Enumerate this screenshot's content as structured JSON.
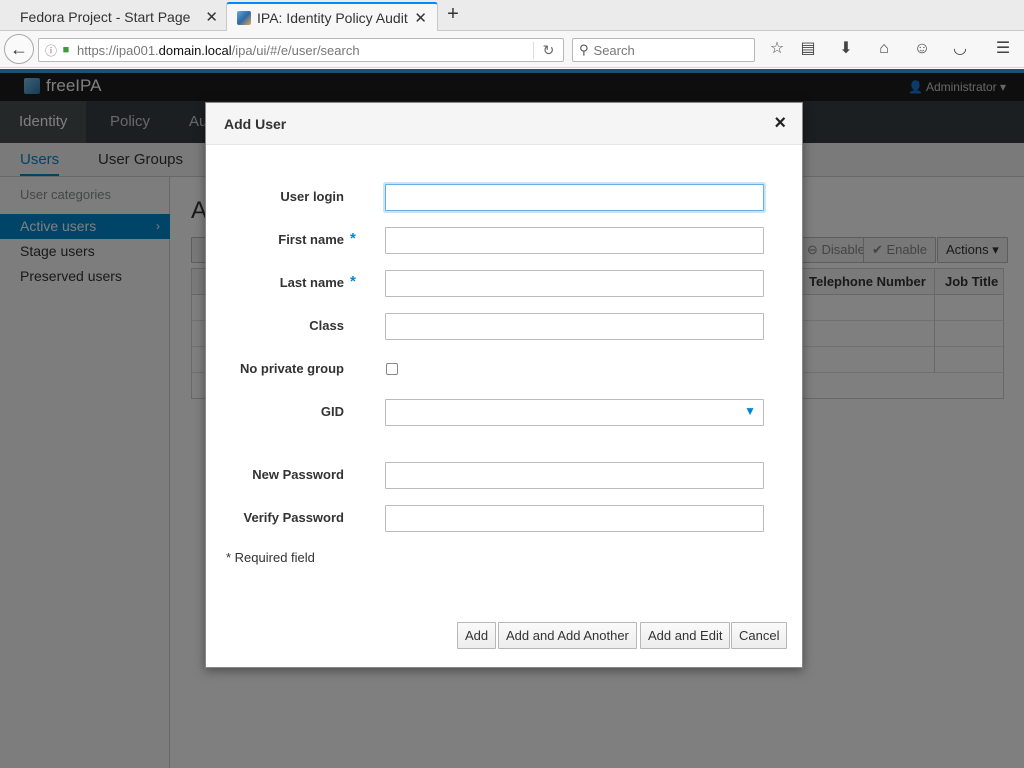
{
  "browser": {
    "tabs": [
      {
        "title": "Fedora Project - Start Page",
        "active": false
      },
      {
        "title": "IPA: Identity Policy Audit",
        "active": true
      }
    ],
    "url_prefix": "https://ipa001.",
    "url_host": "domain.local",
    "url_path": "/ipa/ui/#/e/user/search",
    "search_placeholder": "Search"
  },
  "app": {
    "brand": "freeIPA",
    "user_menu": "Administrator",
    "menu": [
      "Identity",
      "Policy",
      "Au"
    ],
    "subnav": [
      "Users",
      "User Groups"
    ],
    "sidebar": {
      "heading": "User categories",
      "items": [
        "Active users",
        "Stage users",
        "Preserved users"
      ]
    },
    "page_heading": "A",
    "toolbar": {
      "disable": "Disable",
      "enable": "Enable",
      "actions": "Actions"
    },
    "table": {
      "columns": [
        "Telephone Number",
        "Job Title"
      ]
    }
  },
  "dialog": {
    "title": "Add User",
    "fields": {
      "user_login": "User login",
      "first_name": "First name",
      "last_name": "Last name",
      "class": "Class",
      "no_private_group": "No private group",
      "gid": "GID",
      "new_password": "New Password",
      "verify_password": "Verify Password"
    },
    "required_marker": "*",
    "required_note": "* Required field",
    "buttons": {
      "add": "Add",
      "add_another": "Add and Add Another",
      "add_edit": "Add and Edit",
      "cancel": "Cancel"
    }
  }
}
